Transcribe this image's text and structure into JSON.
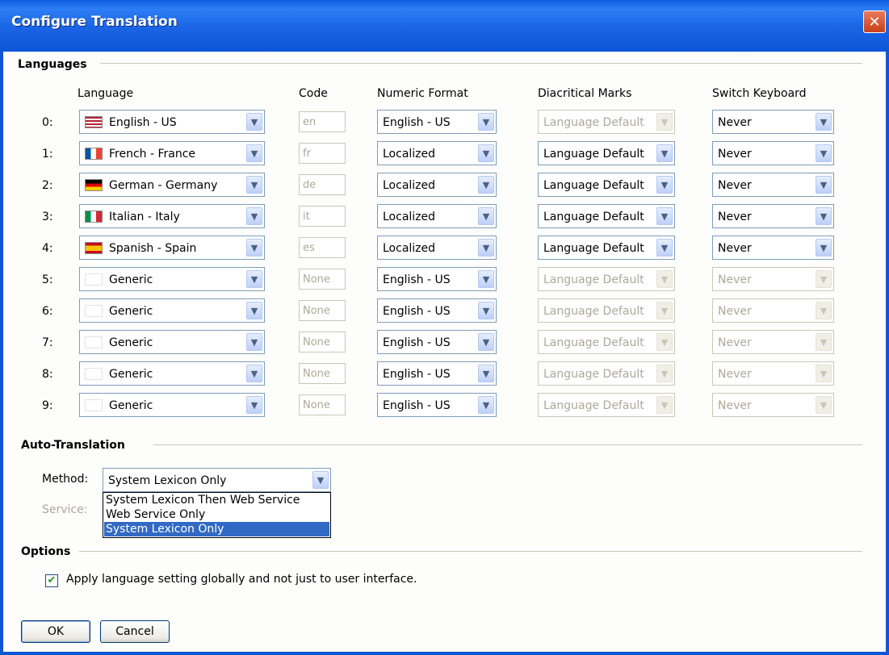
{
  "window": {
    "title": "Configure Translation",
    "close_glyph": "✕"
  },
  "languages_section": {
    "title": "Languages",
    "headers": {
      "language": "Language",
      "code": "Code",
      "numeric_format": "Numeric Format",
      "diacritical_marks": "Diacritical Marks",
      "switch_keyboard": "Switch Keyboard"
    },
    "rows": [
      {
        "num": "0:",
        "language": "English - US",
        "flag": "flag-us-icon",
        "code": "en",
        "numeric": "English - US",
        "diacritics": "Language Default",
        "diacritics_enabled": false,
        "keyboard": "Never",
        "keyboard_enabled": true
      },
      {
        "num": "1:",
        "language": "French - France",
        "flag": "flag-france-icon",
        "code": "fr",
        "numeric": "Localized",
        "diacritics": "Language Default",
        "diacritics_enabled": true,
        "keyboard": "Never",
        "keyboard_enabled": true
      },
      {
        "num": "2:",
        "language": "German - Germany",
        "flag": "flag-germany-icon",
        "code": "de",
        "numeric": "Localized",
        "diacritics": "Language Default",
        "diacritics_enabled": true,
        "keyboard": "Never",
        "keyboard_enabled": true
      },
      {
        "num": "3:",
        "language": "Italian - Italy",
        "flag": "flag-italy-icon",
        "code": "it",
        "numeric": "Localized",
        "diacritics": "Language Default",
        "diacritics_enabled": true,
        "keyboard": "Never",
        "keyboard_enabled": true
      },
      {
        "num": "4:",
        "language": "Spanish - Spain",
        "flag": "flag-spain-icon",
        "code": "es",
        "numeric": "Localized",
        "diacritics": "Language Default",
        "diacritics_enabled": true,
        "keyboard": "Never",
        "keyboard_enabled": true
      },
      {
        "num": "5:",
        "language": "Generic",
        "flag": "flag-generic-icon",
        "code": "None",
        "numeric": "English - US",
        "diacritics": "Language Default",
        "diacritics_enabled": false,
        "keyboard": "Never",
        "keyboard_enabled": false
      },
      {
        "num": "6:",
        "language": "Generic",
        "flag": "flag-generic-icon",
        "code": "None",
        "numeric": "English - US",
        "diacritics": "Language Default",
        "diacritics_enabled": false,
        "keyboard": "Never",
        "keyboard_enabled": false
      },
      {
        "num": "7:",
        "language": "Generic",
        "flag": "flag-generic-icon",
        "code": "None",
        "numeric": "English - US",
        "diacritics": "Language Default",
        "diacritics_enabled": false,
        "keyboard": "Never",
        "keyboard_enabled": false
      },
      {
        "num": "8:",
        "language": "Generic",
        "flag": "flag-generic-icon",
        "code": "None",
        "numeric": "English - US",
        "diacritics": "Language Default",
        "diacritics_enabled": false,
        "keyboard": "Never",
        "keyboard_enabled": false
      },
      {
        "num": "9:",
        "language": "Generic",
        "flag": "flag-generic-icon",
        "code": "None",
        "numeric": "English - US",
        "diacritics": "Language Default",
        "diacritics_enabled": false,
        "keyboard": "Never",
        "keyboard_enabled": false
      }
    ]
  },
  "auto_translation": {
    "title": "Auto-Translation",
    "method_label": "Method:",
    "method_value": "System Lexicon Only",
    "service_label": "Service:",
    "dropdown_options": [
      "System Lexicon Then Web Service",
      "Web Service Only",
      "System Lexicon Only"
    ],
    "selected_option": "System Lexicon Only"
  },
  "options": {
    "title": "Options",
    "apply_globally_label": "Apply language setting globally and not just to user interface.",
    "apply_globally_checked": true,
    "check_glyph": "✔"
  },
  "buttons": {
    "ok": "OK",
    "cancel": "Cancel"
  },
  "arrow_glyph": "▼",
  "colors": {
    "title_bar": "#0a5fe0",
    "selection": "#316ac5",
    "close_button": "#c7401b"
  }
}
